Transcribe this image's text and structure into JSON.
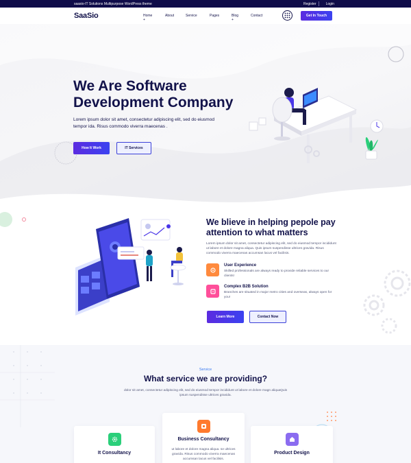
{
  "topbar": {
    "tagline": "saasio-IT Solutions Multipurpose WordPress theme",
    "register": "Register",
    "login": "Login"
  },
  "nav": {
    "logo": "SaaSio",
    "items": [
      "Home +",
      "About",
      "Service",
      "Pages",
      "Blog +",
      "Contact"
    ],
    "grid_icon": "grid-icon",
    "cta": "Get In Touch"
  },
  "hero": {
    "title_line1": "We Are Software",
    "title_line2": "Development Company",
    "description": "Lorem ipsum dolor sit amet, consectetur adipiscing elit, sed do eiusmod tempor ida. Risus commodo viverra maecenas .",
    "primary_button": "How It Work",
    "secondary_button": "IT Services"
  },
  "about": {
    "title": "We blieve in helping pepole pay attention to what matters",
    "description": "Lorem ipsum dolor sit amet, consectetur adipiscing elit, sed do eiusmod tempor incididunt ut labore et dolore magna aliqua. Quis ipsum suspendisse ultrices gravida. Risus commodo viverra maecenas accumsan lacus vel facilisis.",
    "features": [
      {
        "title": "User Experience",
        "description": "Skilled professionals are always ready to provide reliable services to our clients!",
        "icon": "user-experience-icon"
      },
      {
        "title": "Complex B2B Solution",
        "description": "Branches are situated in major metro cities and overseas, always open for you!",
        "icon": "b2b-solution-icon"
      }
    ],
    "primary_button": "Learn More",
    "secondary_button": "Contact Now"
  },
  "services": {
    "label": "Service",
    "title": "What service we are providing?",
    "description": "dolor sit amet, consectetur adipiscing elit, sed do eiusmod tempor incididunt ut labore et dolore magn aliquaQuis ipsum suspendisse ultrices gravida.",
    "cards": [
      {
        "title": "It Consultancy",
        "description": "",
        "icon": "gear-icon"
      },
      {
        "title": "Business Consultancy",
        "description": "ut labore et dolore magna aliqua. se ultrices gravida. Risus commodo viverra maecenas accumsan lacus vel facilisis.",
        "icon": "briefcase-icon"
      },
      {
        "title": "Product Design",
        "description": "",
        "icon": "product-design-icon"
      }
    ]
  },
  "colors": {
    "navy": "#0f0c49",
    "accent": "#4a36e8",
    "orange": "#ff8a3d",
    "pink": "#ff4f9a",
    "green": "#2bcf7a",
    "purple": "#8b6cf0"
  }
}
